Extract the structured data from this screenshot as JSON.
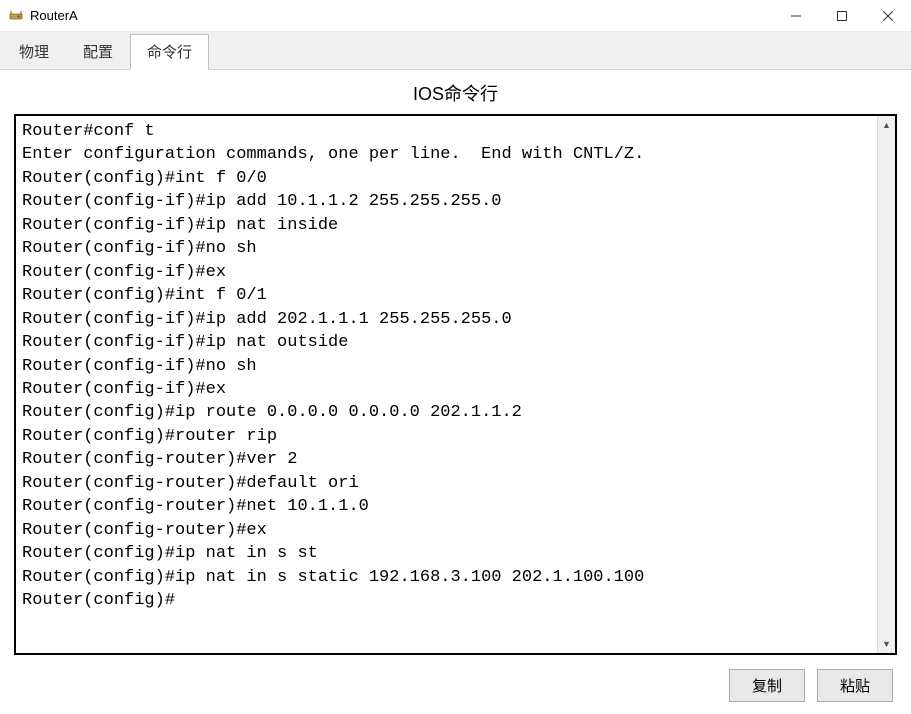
{
  "window": {
    "title": "RouterA"
  },
  "tabs": {
    "physical": "物理",
    "config": "配置",
    "cli": "命令行"
  },
  "cli": {
    "heading": "IOS命令行",
    "lines": [
      "Router#conf t",
      "Enter configuration commands, one per line.  End with CNTL/Z.",
      "Router(config)#int f 0/0",
      "Router(config-if)#ip add 10.1.1.2 255.255.255.0",
      "Router(config-if)#ip nat inside",
      "Router(config-if)#no sh",
      "Router(config-if)#ex",
      "Router(config)#int f 0/1",
      "Router(config-if)#ip add 202.1.1.1 255.255.255.0",
      "Router(config-if)#ip nat outside",
      "Router(config-if)#no sh",
      "Router(config-if)#ex",
      "Router(config)#ip route 0.0.0.0 0.0.0.0 202.1.1.2",
      "Router(config)#router rip",
      "Router(config-router)#ver 2",
      "Router(config-router)#default ori",
      "Router(config-router)#net 10.1.1.0",
      "Router(config-router)#ex",
      "Router(config)#ip nat in s st",
      "Router(config)#ip nat in s static 192.168.3.100 202.1.100.100",
      "Router(config)#"
    ]
  },
  "buttons": {
    "copy": "复制",
    "paste": "粘贴"
  }
}
